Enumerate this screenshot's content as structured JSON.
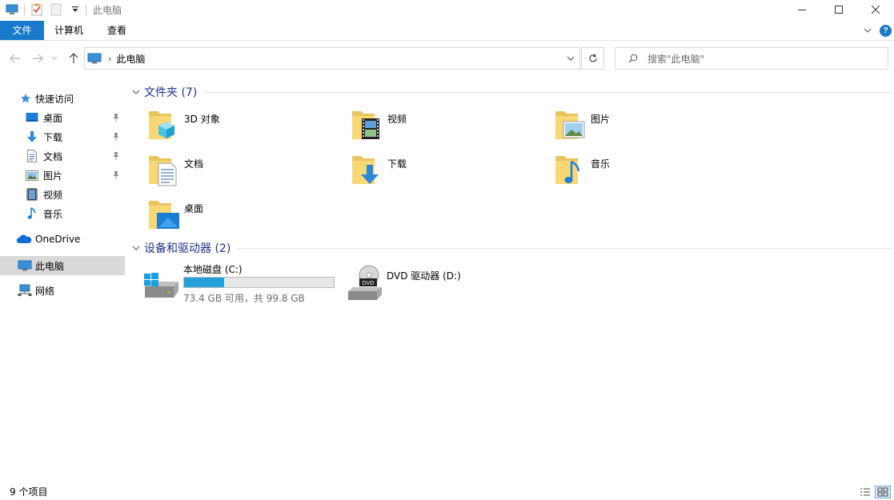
{
  "window": {
    "title": "此电脑"
  },
  "ribbon": {
    "tabs": [
      {
        "label": "文件"
      },
      {
        "label": "计算机"
      },
      {
        "label": "查看"
      }
    ]
  },
  "navigation": {
    "address": {
      "crumbs": [
        "此电脑"
      ]
    },
    "search": {
      "placeholder": "搜索\"此电脑\""
    }
  },
  "sidebar": {
    "items": [
      {
        "label": "快速访问",
        "icon": "star-icon"
      },
      {
        "label": "桌面",
        "icon": "desktop-icon",
        "pinned": true
      },
      {
        "label": "下载",
        "icon": "download-icon",
        "pinned": true
      },
      {
        "label": "文档",
        "icon": "document-icon",
        "pinned": true
      },
      {
        "label": "图片",
        "icon": "pictures-icon",
        "pinned": true
      },
      {
        "label": "视频",
        "icon": "videos-icon"
      },
      {
        "label": "音乐",
        "icon": "music-icon"
      },
      {
        "label": "OneDrive",
        "icon": "cloud-icon"
      },
      {
        "label": "此电脑",
        "icon": "computer-icon",
        "selected": true
      },
      {
        "label": "网络",
        "icon": "network-icon"
      }
    ]
  },
  "groups": {
    "folders": {
      "title": "文件夹 (7)",
      "items": [
        {
          "label": "3D 对象",
          "icon": "3d-objects-folder-icon"
        },
        {
          "label": "视频",
          "icon": "videos-folder-icon"
        },
        {
          "label": "图片",
          "icon": "pictures-folder-icon"
        },
        {
          "label": "文档",
          "icon": "documents-folder-icon"
        },
        {
          "label": "下载",
          "icon": "downloads-folder-icon"
        },
        {
          "label": "音乐",
          "icon": "music-folder-icon"
        },
        {
          "label": "桌面",
          "icon": "desktop-folder-icon"
        }
      ]
    },
    "devices": {
      "title": "设备和驱动器 (2)",
      "items": [
        {
          "label": "本地磁盘 (C:)",
          "icon": "local-disk-icon",
          "usage": "73.4 GB 可用，共 99.8 GB",
          "used_fraction": 0.265
        },
        {
          "label": "DVD 驱动器 (D:)",
          "icon": "dvd-drive-icon"
        }
      ]
    }
  },
  "status": {
    "item_count": "9 个项目"
  },
  "colors": {
    "accent": "#1979ca",
    "group_title": "#1e3287",
    "selection": "#d9d9d9",
    "drive_fill": "#26a0da",
    "folder_yellow": "#f8d775"
  }
}
